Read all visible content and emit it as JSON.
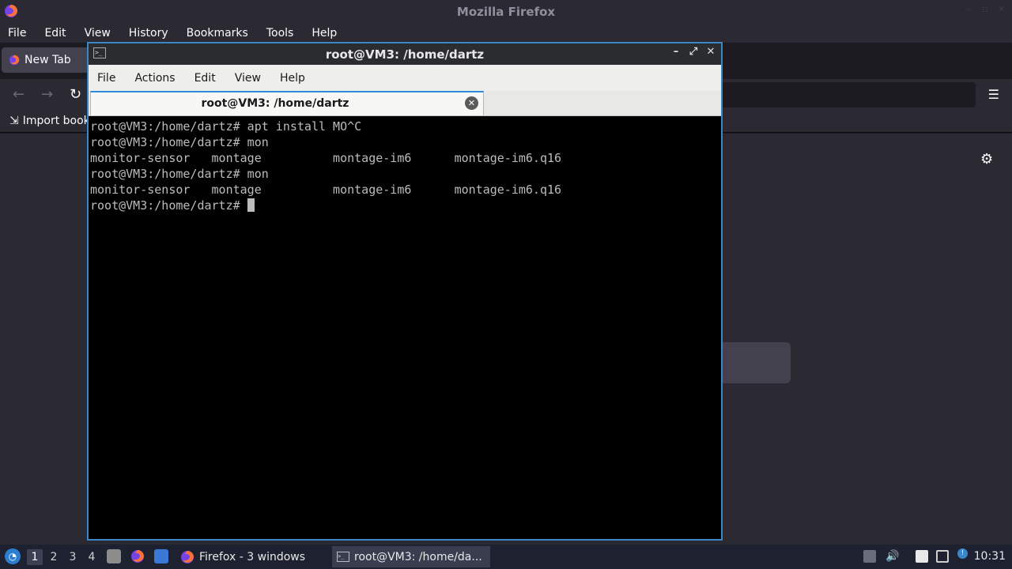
{
  "firefox": {
    "window_title": "Mozilla Firefox",
    "menu": [
      "File",
      "Edit",
      "View",
      "History",
      "Bookmarks",
      "Tools",
      "Help"
    ],
    "tab_label": "New Tab",
    "bookmark_import_label": "Import book"
  },
  "terminal": {
    "window_title": "root@VM3: /home/dartz",
    "menu": [
      "File",
      "Actions",
      "Edit",
      "View",
      "Help"
    ],
    "tab_label": "root@VM3: /home/dartz",
    "lines": [
      "root@VM3:/home/dartz# apt install MO^C",
      "root@VM3:/home/dartz# mon",
      "monitor-sensor   montage          montage-im6      montage-im6.q16",
      "root@VM3:/home/dartz# mon",
      "monitor-sensor   montage          montage-im6      montage-im6.q16"
    ],
    "prompt": "root@VM3:/home/dartz# "
  },
  "taskbar": {
    "workspaces": [
      "1",
      "2",
      "3",
      "4"
    ],
    "active_workspace": "1",
    "tasks": [
      {
        "label": "Firefox - 3 windows"
      },
      {
        "label": "root@VM3: /home/da..."
      }
    ],
    "clock": "10:31"
  },
  "colors": {
    "terminal_border": "#3a86c7",
    "firefox_bg": "#2b2a33",
    "taskbar_bg": "#1e2130"
  }
}
